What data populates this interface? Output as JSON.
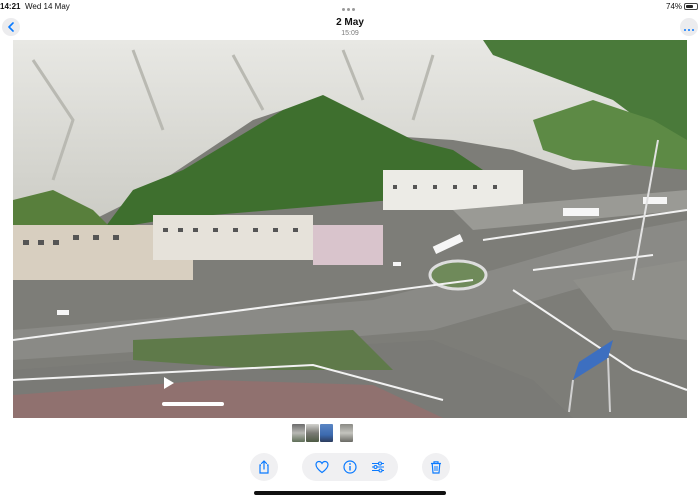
{
  "status_bar": {
    "time": "14:21",
    "date": "Wed 14 May",
    "battery_percent": "74%",
    "battery_level": 0.74
  },
  "nav": {
    "title": "2 May",
    "subtitle": "15:09"
  },
  "photo": {
    "playback_progress": 0
  },
  "thumbnails": {
    "count": 4,
    "selected_index": 2
  },
  "toolbar": {
    "icons": [
      "share-icon",
      "heart-icon",
      "info-icon",
      "adjust-icon",
      "trash-icon"
    ]
  },
  "colors": {
    "accent": "#0a7aff"
  }
}
